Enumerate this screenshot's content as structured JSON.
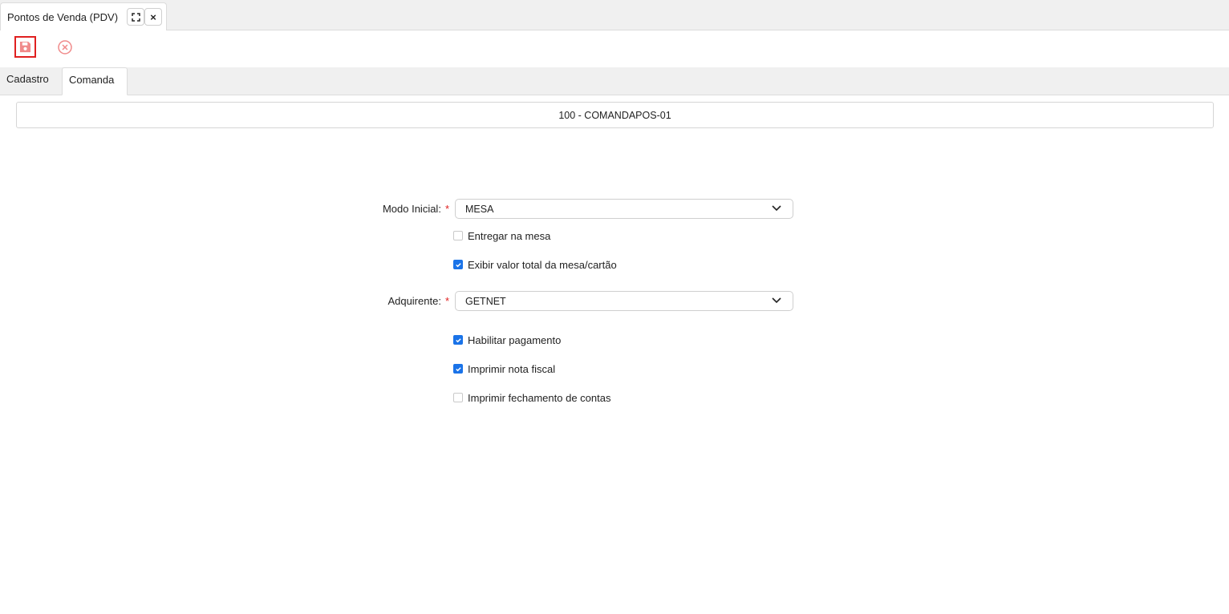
{
  "window": {
    "tab_title": "Pontos de Venda (PDV)",
    "close_label": "×"
  },
  "toolbar": {
    "save_icon": "save-icon",
    "cancel_icon": "cancel-icon"
  },
  "form_tabs": [
    {
      "label": "Cadastro",
      "active": false
    },
    {
      "label": "Comanda",
      "active": true
    }
  ],
  "record": {
    "title": "100 -  COMANDAPOS-01"
  },
  "fields": {
    "modo_inicial": {
      "label": "Modo Inicial:",
      "required_mark": "*",
      "value": "MESA"
    },
    "adquirente": {
      "label": "Adquirente:",
      "required_mark": "*",
      "value": "GETNET"
    }
  },
  "checkboxes": [
    {
      "label": "Entregar na mesa",
      "checked": false
    },
    {
      "label": "Exibir valor total da mesa/cartão",
      "checked": true
    },
    {
      "label": "Habilitar pagamento",
      "checked": true
    },
    {
      "label": "Imprimir nota fiscal",
      "checked": true
    },
    {
      "label": "Imprimir fechamento de contas",
      "checked": false
    }
  ],
  "colors": {
    "accent": "#1a73e8",
    "required": "#e02020",
    "save_icon": "#f08a8a"
  }
}
